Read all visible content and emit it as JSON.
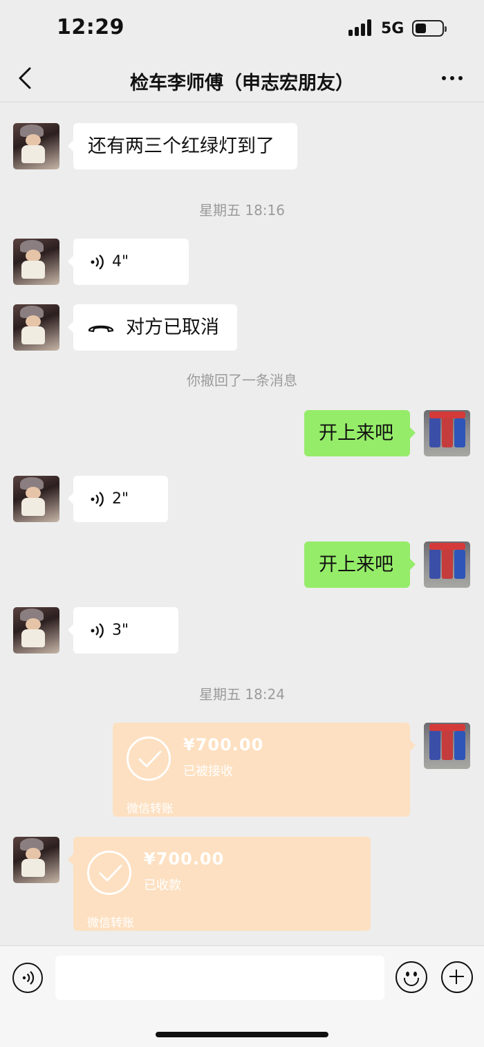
{
  "status_bar": {
    "time": "12:29",
    "network": "5G",
    "battery_level": 0.4
  },
  "nav": {
    "title": "检车李师傅（申志宏朋友）",
    "back_icon": "chevron-left-icon",
    "more_icon": "ellipsis-icon"
  },
  "messages": [
    {
      "type": "text",
      "side": "in",
      "text": "还有两三个红绿灯到了"
    },
    {
      "type": "timestamp",
      "text": "星期五 18:16"
    },
    {
      "type": "voice",
      "side": "in",
      "duration": "4\""
    },
    {
      "type": "call",
      "side": "in",
      "text": "对方已取消"
    },
    {
      "type": "system",
      "text": "你撤回了一条消息"
    },
    {
      "type": "text",
      "side": "out",
      "text": "开上来吧"
    },
    {
      "type": "voice",
      "side": "in",
      "duration": "2\""
    },
    {
      "type": "text",
      "side": "out",
      "text": "开上来吧"
    },
    {
      "type": "voice",
      "side": "in",
      "duration": "3\""
    },
    {
      "type": "timestamp",
      "text": "星期五 18:24"
    },
    {
      "type": "transfer",
      "side": "out",
      "amount": "¥700.00",
      "status": "已被接收",
      "label": "微信转账"
    },
    {
      "type": "transfer",
      "side": "in",
      "amount": "¥700.00",
      "status": "已收款",
      "label": "微信转账"
    }
  ],
  "input_bar": {
    "voice_icon": "voice-input-icon",
    "emoji_icon": "emoji-icon",
    "plus_icon": "plus-icon"
  },
  "colors": {
    "background": "#ededed",
    "outgoing_bubble": "#95ec69",
    "incoming_bubble": "#ffffff",
    "transfer_card": "#fde0c1"
  }
}
